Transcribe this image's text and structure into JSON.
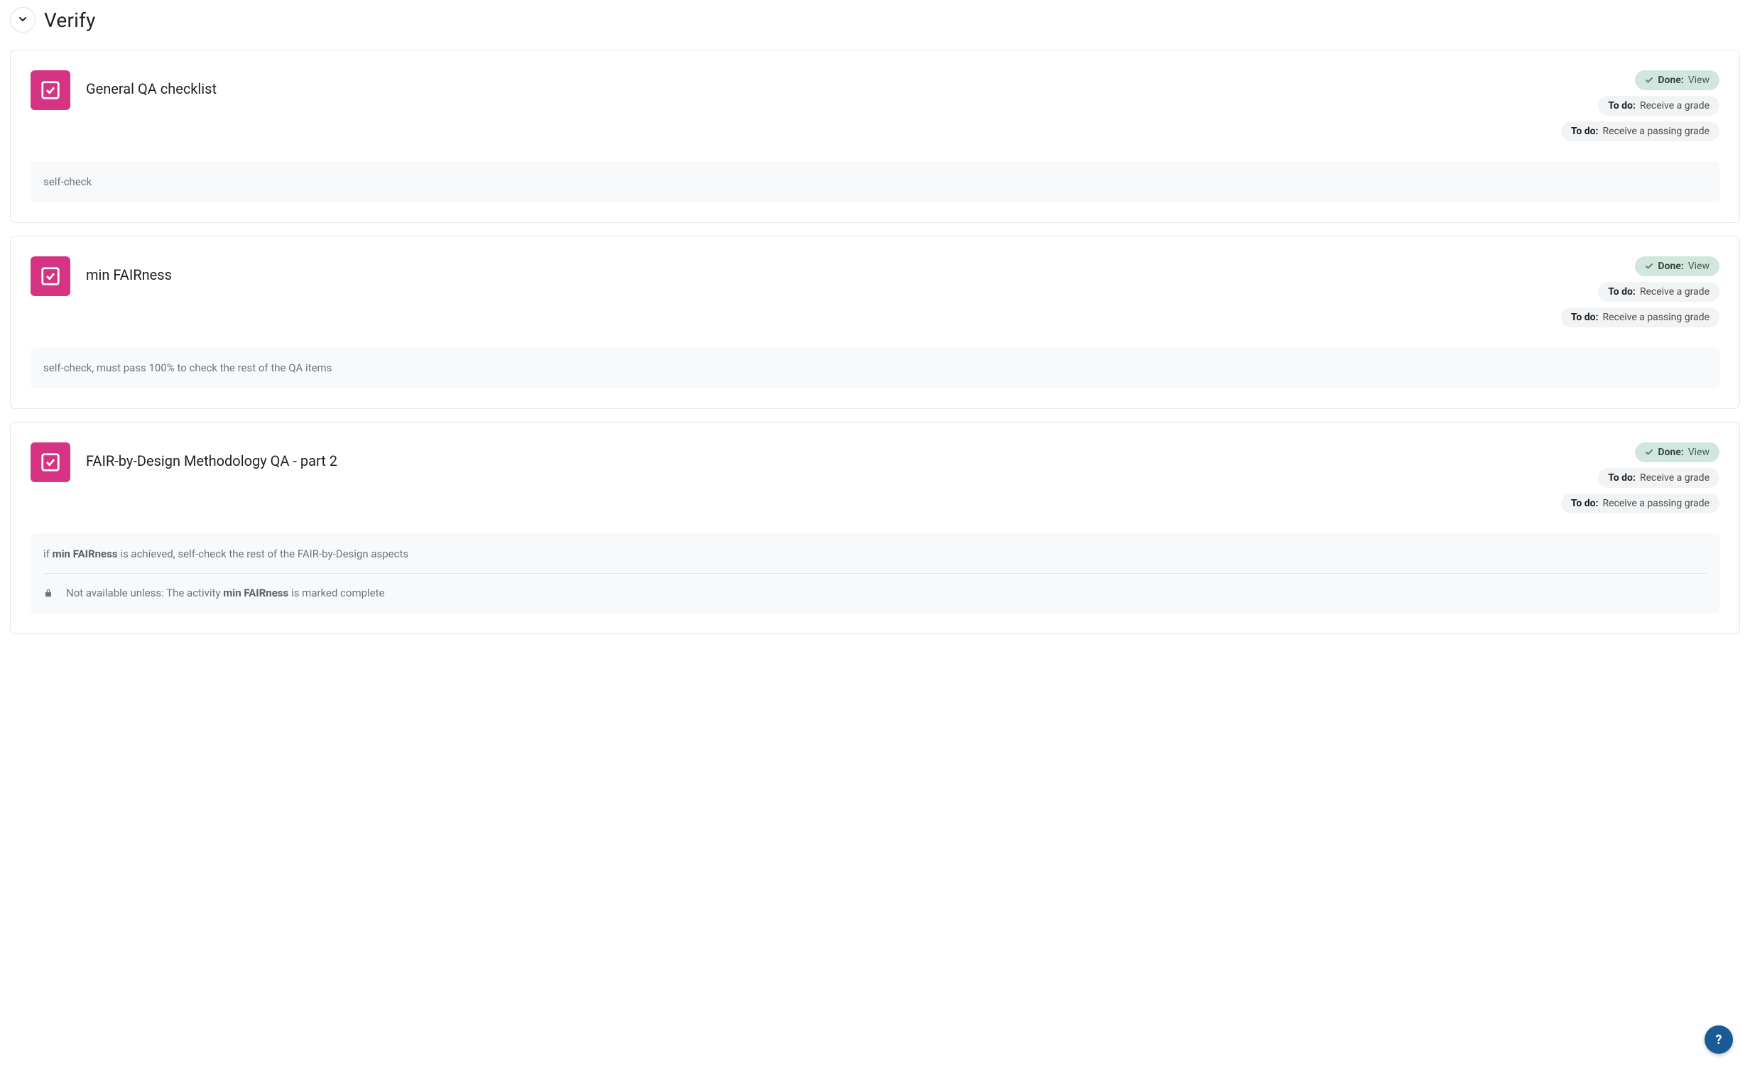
{
  "section": {
    "title": "Verify"
  },
  "badge_labels": {
    "done": "Done:",
    "view": "View",
    "todo": "To do:",
    "receive_grade": "Receive a grade",
    "receive_passing_grade": "Receive a passing grade"
  },
  "activities": [
    {
      "title": "General QA checklist",
      "description_plain": "self-check"
    },
    {
      "title": "min FAIRness",
      "description_plain": "self-check, must pass 100% to check the rest of the QA items"
    },
    {
      "title": "FAIR-by-Design Methodology QA - part 2",
      "desc": {
        "prefix": "if ",
        "bold": "min FAIRness",
        "suffix": " is achieved, self-check the rest of the FAIR-by-Design aspects"
      },
      "restriction": {
        "prefix": "Not available unless: The activity ",
        "bold": "min FAIRness",
        "suffix": " is marked complete"
      }
    }
  ],
  "help": {
    "label": "?"
  }
}
